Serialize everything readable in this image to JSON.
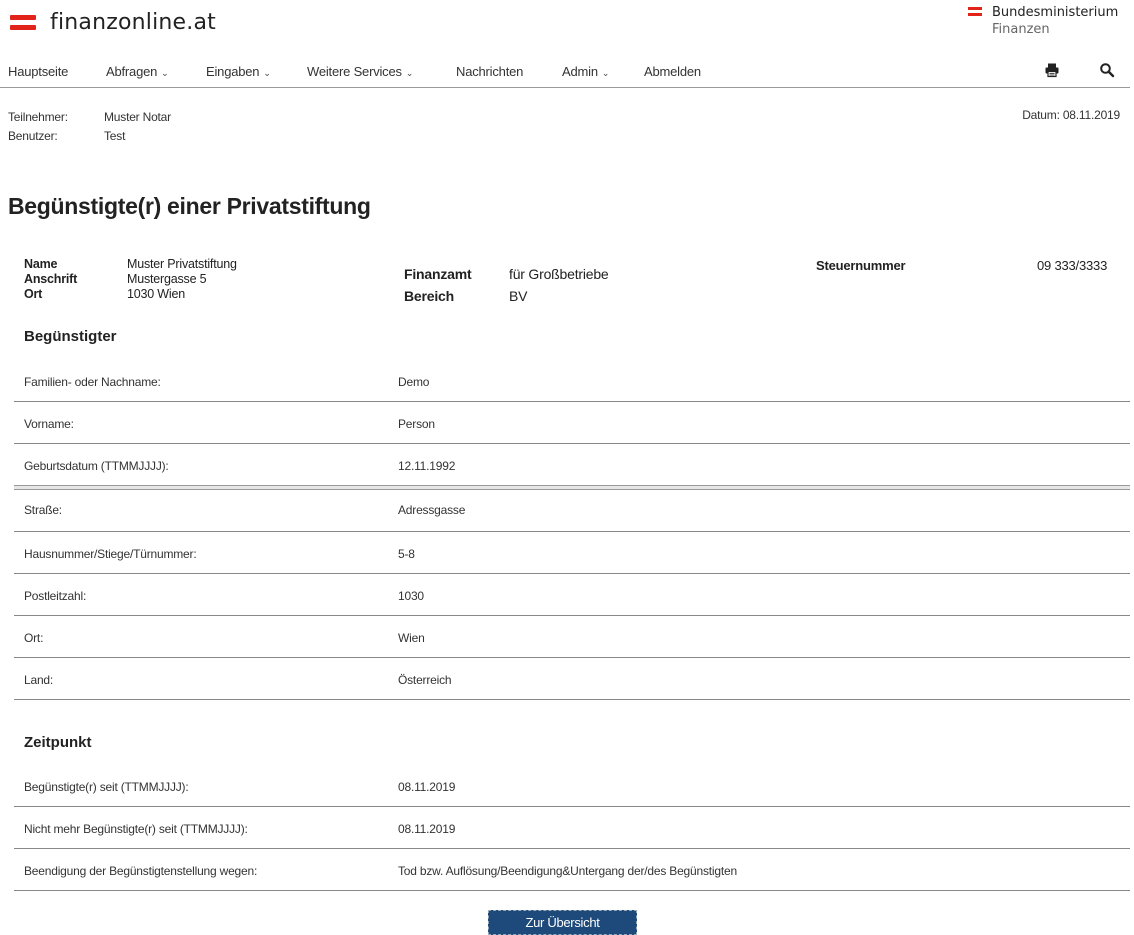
{
  "header": {
    "brand": "finanzonline.at",
    "ministry_line1": "Bundesministerium",
    "ministry_line2": "Finanzen"
  },
  "nav": {
    "items": [
      {
        "label": "Hauptseite",
        "dropdown": false
      },
      {
        "label": "Abfragen",
        "dropdown": true
      },
      {
        "label": "Eingaben",
        "dropdown": true
      },
      {
        "label": "Weitere Services",
        "dropdown": true
      },
      {
        "label": "Nachrichten",
        "dropdown": false
      },
      {
        "label": "Admin",
        "dropdown": true
      },
      {
        "label": "Abmelden",
        "dropdown": false
      }
    ],
    "icons": [
      "print-icon",
      "search-icon"
    ]
  },
  "session": {
    "teilnehmer_label": "Teilnehmer:",
    "teilnehmer": "Muster Notar",
    "benutzer_label": "Benutzer:",
    "benutzer": "Test",
    "datum": "Datum: 08.11.2019"
  },
  "page_title": "Begünstigte(r) einer Privatstiftung",
  "summary": {
    "name_label": "Name",
    "name": "Muster Privatstiftung",
    "anschrift_label": "Anschrift",
    "anschrift": "Mustergasse 5",
    "ort_label": "Ort",
    "ort": "1030 Wien",
    "finanzamt_label": "Finanzamt",
    "finanzamt": "für Großbetriebe",
    "bereich_label": "Bereich",
    "bereich": "BV",
    "steuernummer_label": "Steuernummer",
    "steuernummer": "09 333/3333"
  },
  "beguenstigter": {
    "heading": "Begünstigter",
    "rows_person": [
      {
        "label": "Familien- oder Nachname:",
        "value": "Demo"
      },
      {
        "label": "Vorname:",
        "value": "Person"
      },
      {
        "label": "Geburtsdatum (TTMMJJJJ):",
        "value": "12.11.1992"
      }
    ],
    "rows_address": [
      {
        "label": "Straße:",
        "value": "Adressgasse"
      },
      {
        "label": "Hausnummer/Stiege/Türnummer:",
        "value": "5-8"
      },
      {
        "label": "Postleitzahl:",
        "value": "1030"
      },
      {
        "label": "Ort:",
        "value": "Wien"
      },
      {
        "label": "Land:",
        "value": "Österreich"
      }
    ]
  },
  "zeitpunkt": {
    "heading": "Zeitpunkt",
    "rows": [
      {
        "label": "Begünstigte(r) seit (TTMMJJJJ):",
        "value": "08.11.2019"
      },
      {
        "label": "Nicht mehr Begünstigte(r) seit (TTMMJJJJ):",
        "value": "08.11.2019"
      },
      {
        "label": "Beendigung der Begünstigtenstellung wegen:",
        "value": "Tod bzw. Auflösung/Beendigung&Untergang der/des Begünstigten"
      }
    ]
  },
  "actions": {
    "overview_button": "Zur Übersicht"
  }
}
